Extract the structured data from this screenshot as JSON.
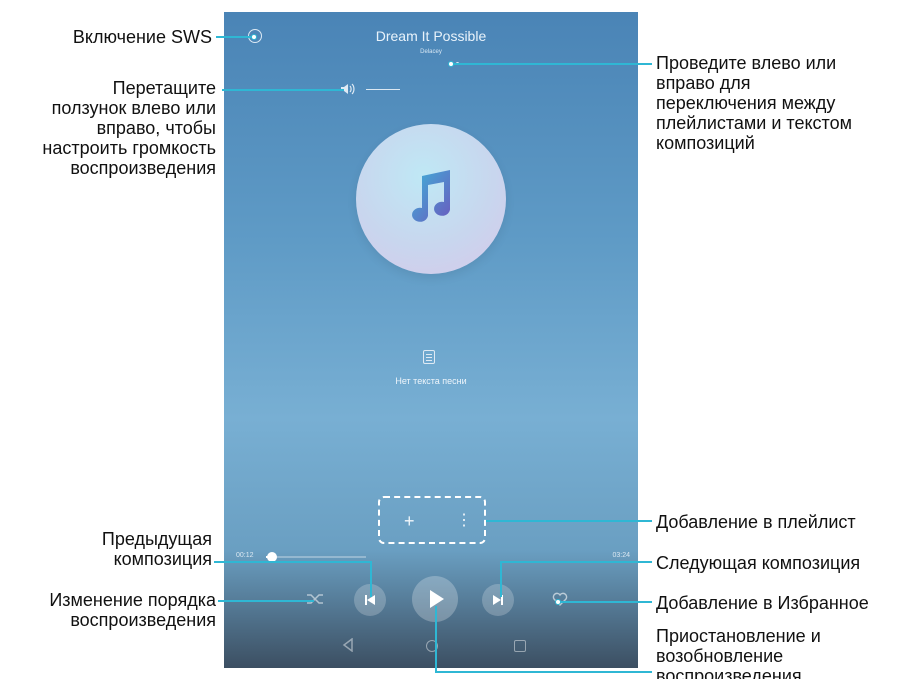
{
  "player": {
    "song_title": "Dream It Possible",
    "artist": "Delacey",
    "no_lyrics": "Нет текста песни",
    "time_elapsed": "00:12",
    "time_total": "03:24",
    "progress": 0.06,
    "volume_level": 0.0
  },
  "controls": {
    "add_symbol": "+",
    "more_symbol": "⋮"
  },
  "icons": {
    "sws": "sws-icon",
    "volume": "volume-icon",
    "album": "music-note-icon",
    "lyrics": "lyrics-doc-icon",
    "shuffle": "shuffle-icon",
    "prev": "previous-icon",
    "play": "play-icon",
    "next": "next-icon",
    "favorite": "heart-icon",
    "back": "back-icon",
    "home": "home-icon",
    "recent": "recent-apps-icon"
  },
  "annotations": {
    "sws": "Включение SWS",
    "volume": [
      "Перетащите",
      "ползунок влево или",
      "вправо, чтобы",
      "настроить громкость",
      "воспроизведения"
    ],
    "swipe": [
      "Проведите влево или",
      "вправо для",
      "переключения между",
      "плейлистами и текстом",
      "композиций"
    ],
    "add_playlist": "Добавление в плейлист",
    "prev": [
      "Предыдущая",
      "композиция"
    ],
    "next": "Следующая композиция",
    "shuffle": [
      "Изменение порядка",
      "воспроизведения"
    ],
    "favorite": "Добавление в Избранное",
    "play": [
      "Приостановление и",
      "возобновление",
      "воспроизведения"
    ]
  },
  "colors": {
    "accent_line": "#2fb7d4",
    "screen_top": "#4a84b6",
    "screen_bottom": "#3c4f62"
  }
}
